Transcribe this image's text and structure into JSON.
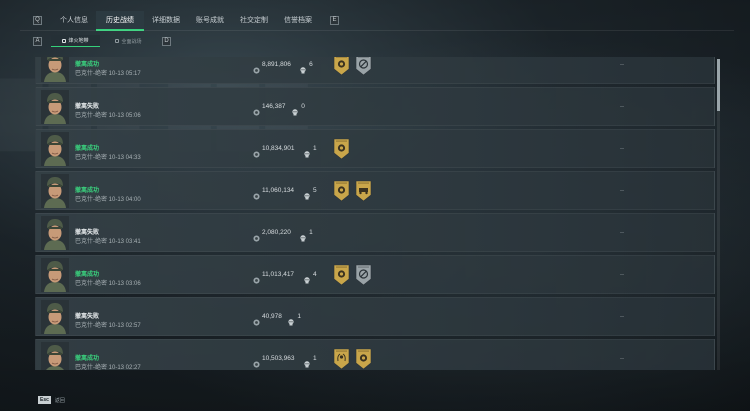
{
  "tabs": {
    "prev_key": "Q",
    "next_key": "E",
    "items": [
      {
        "label": "个人信息"
      },
      {
        "label": "历史战绩"
      },
      {
        "label": "详细数据"
      },
      {
        "label": "账号成就"
      },
      {
        "label": "社交定制"
      },
      {
        "label": "信誉档案"
      }
    ],
    "active_index": 1
  },
  "subtabs": {
    "prev_key": "A",
    "next_key": "D",
    "items": [
      {
        "label": "烽火地带"
      },
      {
        "label": "全面战场"
      }
    ],
    "active_index": 0
  },
  "colors": {
    "accent_green": "#35d07a",
    "success_text": "#3ad27e",
    "badge_gold": "#c9a64a",
    "badge_gray": "#9aa3a7"
  },
  "records": [
    {
      "result": "撤离成功",
      "status": "success",
      "meta": "巴克什-绝密 10-13 05:17",
      "value": "8,891,806",
      "kills": "6",
      "badges": [
        "gold-emblem-badge",
        "gray-no-sign-badge"
      ],
      "extra": "--"
    },
    {
      "result": "撤离失败",
      "status": "fail",
      "meta": "巴克什-绝密 10-13 05:06",
      "value": "146,387",
      "kills": "0",
      "badges": [],
      "extra": "--"
    },
    {
      "result": "撤离成功",
      "status": "success",
      "meta": "巴克什-绝密 10-13 04:33",
      "value": "10,834,901",
      "kills": "1",
      "badges": [
        "gold-emblem-badge"
      ],
      "extra": "--"
    },
    {
      "result": "撤离成功",
      "status": "success",
      "meta": "巴克什-绝密 10-13 04:00",
      "value": "11,060,134",
      "kills": "5",
      "badges": [
        "gold-emblem-badge",
        "gold-vehicle-badge"
      ],
      "extra": "--"
    },
    {
      "result": "撤离失败",
      "status": "fail",
      "meta": "巴克什-绝密 10-13 03:41",
      "value": "2,080,220",
      "kills": "1",
      "badges": [],
      "extra": "--"
    },
    {
      "result": "撤离成功",
      "status": "success",
      "meta": "巴克什-绝密 10-13 03:06",
      "value": "11,013,417",
      "kills": "4",
      "badges": [
        "gold-emblem-badge",
        "gray-no-sign-badge"
      ],
      "extra": "--"
    },
    {
      "result": "撤离失败",
      "status": "fail",
      "meta": "巴克什-绝密 10-13 02:57",
      "value": "40,978",
      "kills": "1",
      "badges": [],
      "extra": "--"
    },
    {
      "result": "撤离成功",
      "status": "success",
      "meta": "巴克什-绝密 10-13 02:27",
      "value": "10,503,963",
      "kills": "1",
      "badges": [
        "gold-wreath-badge",
        "gold-emblem-badge"
      ],
      "extra": "--"
    }
  ],
  "footer": {
    "key": "Esc",
    "label": "返回"
  }
}
